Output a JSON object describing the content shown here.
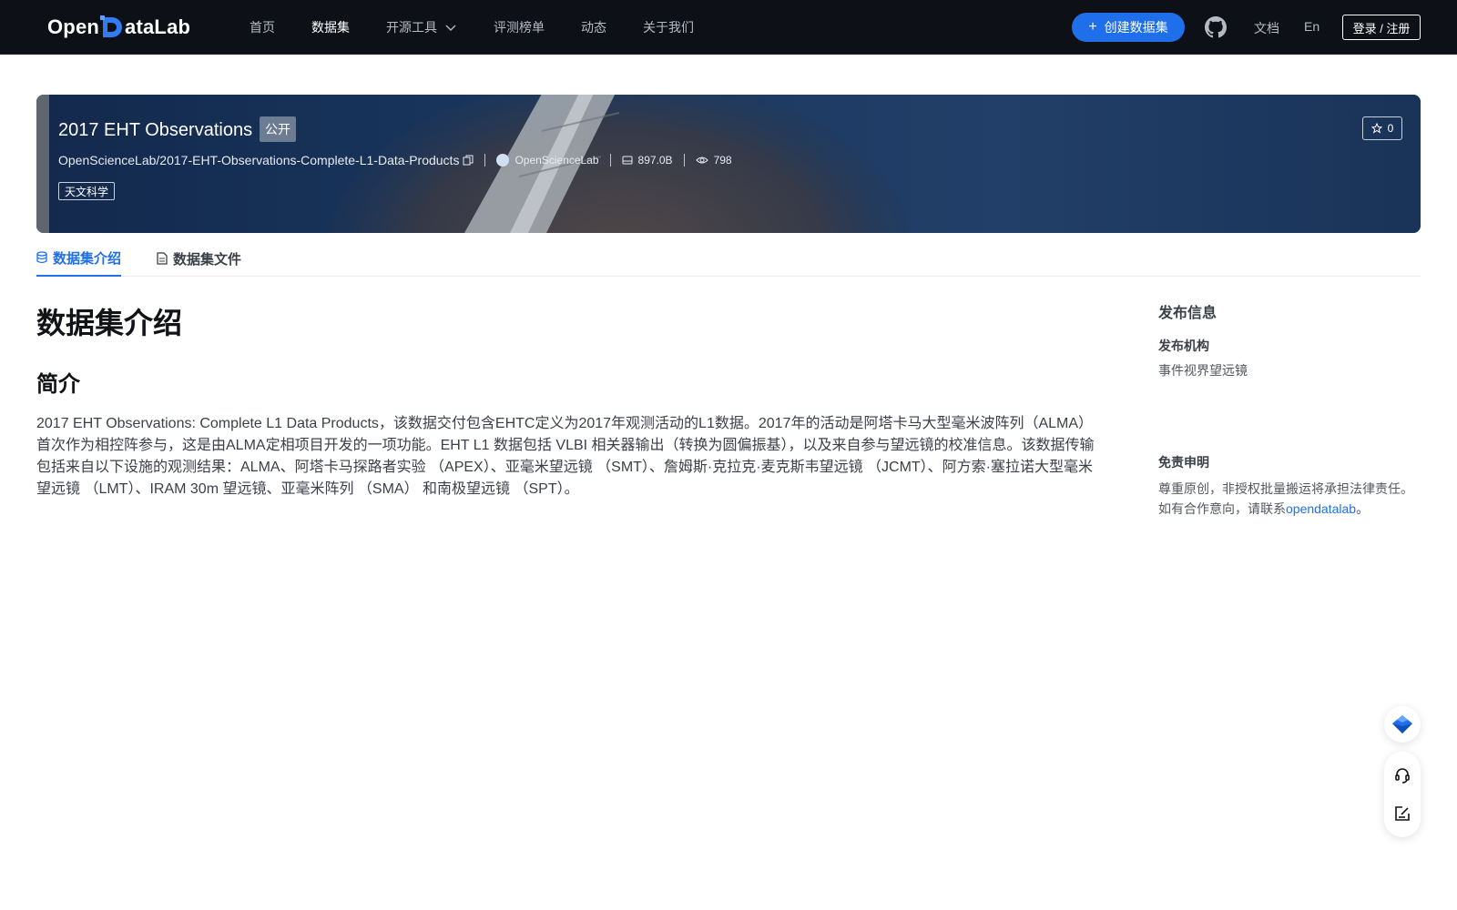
{
  "header": {
    "logo": {
      "prefix": "Open",
      "suffix": "ataLab"
    },
    "nav": [
      {
        "label": "首页",
        "active": false
      },
      {
        "label": "数据集",
        "active": true
      },
      {
        "label": "开源工具",
        "active": false
      },
      {
        "label": "评测榜单",
        "active": false
      },
      {
        "label": "动态",
        "active": false
      },
      {
        "label": "关于我们",
        "active": false
      }
    ],
    "create_button": "创建数据集",
    "docs_label": "文档",
    "lang_label": "En",
    "login_label": "登录 / 注册"
  },
  "dataset": {
    "title": "2017 EHT Observations",
    "visibility": "公开",
    "repo_path": "OpenScienceLab/2017-EHT-Observations-Complete-L1-Data-Products",
    "org": "OpenScienceLab",
    "size": "897.0B",
    "views": "798",
    "stars": "0",
    "tag": "天文科学"
  },
  "tabs": [
    {
      "label": "数据集介绍",
      "active": true
    },
    {
      "label": "数据集文件",
      "active": false
    }
  ],
  "content": {
    "heading": "数据集介绍",
    "subheading": "简介",
    "paragraph": "2017 EHT Observations: Complete L1 Data Products，该数据交付包含EHTC定义为2017年观测活动的L1数据。2017年的活动是阿塔卡马大型毫米波阵列（ALMA）首次作为相控阵参与，这是由ALMA定相项目开发的一项功能。EHT L1 数据包括 VLBI 相关器输出（转换为圆偏振基），以及来自参与望远镜的校准信息。该数据传输包括来自以下设施的观测结果：ALMA、阿塔卡马探路者实验 （APEX）、亚毫米望远镜 （SMT）、詹姆斯·克拉克·麦克斯韦望远镜 （JCMT）、阿方索·塞拉诺大型毫米望远镜 （LMT）、IRAM 30m 望远镜、亚毫米阵列 （SMA） 和南极望远镜 （SPT）。"
  },
  "sidebar": {
    "title": "发布信息",
    "publisher_label": "发布机构",
    "publisher_value": "事件视界望远镜",
    "disclaimer_label": "免责申明",
    "disclaimer_line1": "尊重原创，非授权批量搬运将承担法律责任。",
    "disclaimer_line2_prefix": "如有合作意向，请联系",
    "disclaimer_link": "opendatalab",
    "disclaimer_line2_suffix": "。"
  },
  "icons": {
    "nav_dropdown": "chevron-down-icon",
    "create": "plus-icon",
    "github": "github-icon",
    "copy": "copy-icon",
    "size": "disk-icon",
    "views": "eye-icon",
    "star": "star-icon",
    "tab_intro": "database-icon",
    "tab_files": "file-icon",
    "float_top": "diamond-logo-icon",
    "float_support": "headset-icon",
    "float_feedback": "edit-note-icon"
  },
  "colors": {
    "header_bg": "#0d1117",
    "accent": "#1f6feb",
    "banner_bg": "#173259"
  }
}
